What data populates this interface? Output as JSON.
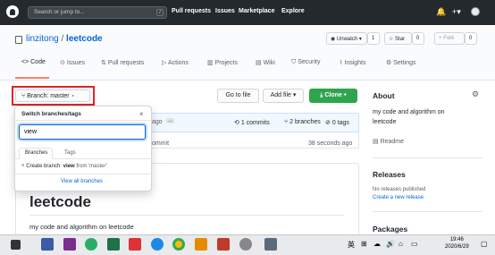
{
  "header": {
    "search_placeholder": "Search or jump to...",
    "search_key": "/",
    "nav": [
      "Pull requests",
      "Issues",
      "Marketplace",
      "Explore"
    ]
  },
  "repo": {
    "owner": "linzitong",
    "separator": "/",
    "name": "leetcode",
    "unwatch_label": "Unwatch",
    "watch_count": "1",
    "star_label": "Star",
    "star_count": "0",
    "fork_label": "Fork",
    "fork_count": "0"
  },
  "tabs": [
    "Code",
    "Issues",
    "Pull requests",
    "Actions",
    "Projects",
    "Wiki",
    "Security",
    "Insights",
    "Settings"
  ],
  "toolbar": {
    "branch_label": "Branch: master",
    "go_to_file": "Go to file",
    "add_file": "Add file",
    "clone": "Clone"
  },
  "commit_bar": {
    "ago": "ago",
    "dots": "...",
    "commits": "1 commits",
    "branches": "2 branches",
    "tags": "0 tags",
    "file_row_text": "ommit",
    "file_row_time": "38 seconds ago"
  },
  "dropdown": {
    "title": "Switch branches/tags",
    "close": "×",
    "input_value": "view",
    "tab_branches": "Branches",
    "tab_tags": "Tags",
    "create_prefix": "Create branch: ",
    "create_name": "view",
    "create_suffix": " from 'master'",
    "view_all": "View all branches"
  },
  "readme": {
    "heading": "leetcode",
    "description": "my code and algorithm on leetcode"
  },
  "sidebar": {
    "about_title": "About",
    "about_text_1": "my code and algorithm on",
    "about_text_2": "leetcode",
    "readme_link": "Readme",
    "releases_title": "Releases",
    "no_releases": "No releases published",
    "create_release": "Create a new release",
    "packages_title": "Packages"
  },
  "taskbar": {
    "ime": "英",
    "time": "19:46",
    "date": "2020/6/29"
  },
  "colors": {
    "header_bg": "#24292e",
    "link": "#0366d6",
    "clone_green": "#2ea44f",
    "highlight_red": "#e02424",
    "tab_underline": "#f9826c"
  }
}
